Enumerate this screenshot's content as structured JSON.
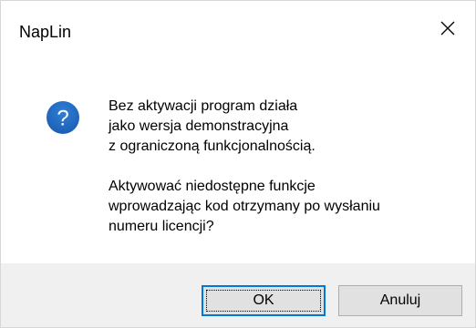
{
  "window": {
    "title": "NapLin",
    "close_icon": "close-icon"
  },
  "message": {
    "icon": "question-icon",
    "icon_glyph": "?",
    "icon_color": "#1c5fb4",
    "paragraph1": [
      "Bez aktywacji program działa",
      "jako wersja demonstracyjna",
      "z ograniczoną funkcjonalnością."
    ],
    "paragraph2": [
      "Aktywować niedostępne funkcje",
      "wprowadzając kod otrzymany po wysłaniu",
      "numeru licencji?"
    ]
  },
  "buttons": {
    "ok_label": "OK",
    "cancel_label": "Anuluj",
    "focused_button_color": "#0078d7"
  }
}
